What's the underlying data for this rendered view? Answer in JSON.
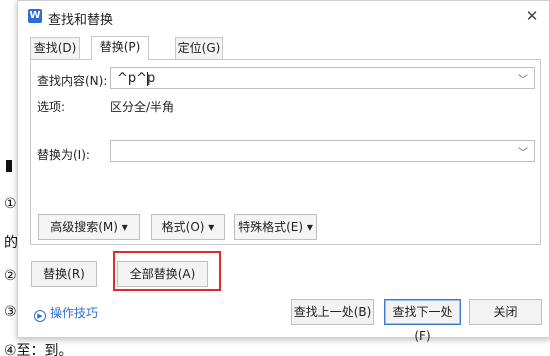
{
  "background_doc": {
    "markers": [
      "①",
      "的",
      "②",
      "③",
      "④至：到。"
    ]
  },
  "dialog": {
    "app_icon_label": "W",
    "title": "查找和替换",
    "close_glyph": "✕",
    "tabs": [
      {
        "label": "查找(D)",
        "active": false
      },
      {
        "label": "替换(P)",
        "active": true
      },
      {
        "label": "定位(G)",
        "active": false
      }
    ],
    "find": {
      "label": "查找内容(N):",
      "value": "^p^p"
    },
    "options": {
      "label": "选项:",
      "value": "区分全/半角"
    },
    "replace": {
      "label": "替换为(I):",
      "value": ""
    },
    "option_buttons": {
      "advanced_search": "高级搜索(M) ▾",
      "format": "格式(O) ▾",
      "special_format": "特殊格式(E) ▾"
    },
    "action_buttons": {
      "replace": "替换(R)",
      "replace_all": "全部替换(A)"
    },
    "tips_label": "操作技巧",
    "footer_buttons": {
      "find_prev": "查找上一处(B)",
      "find_next": "查找下一处(F)",
      "close": "关闭"
    },
    "colors": {
      "accent": "#2b6fd6",
      "highlight": "#e02a2a"
    }
  }
}
